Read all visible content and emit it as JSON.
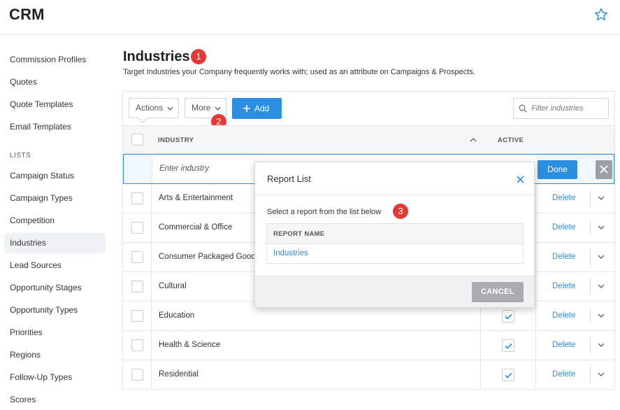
{
  "app": {
    "title": "CRM"
  },
  "sidebar": {
    "items_top": [
      "Commission Profiles",
      "Quotes",
      "Quote Templates",
      "Email Templates"
    ],
    "section_label": "LISTS",
    "items_lists": [
      "Campaign Status",
      "Campaign Types",
      "Competition",
      "Industries",
      "Lead Sources",
      "Opportunity Stages",
      "Opportunity Types",
      "Priorities",
      "Regions",
      "Follow-Up Types",
      "Scores"
    ],
    "active": "Industries"
  },
  "page": {
    "title": "Industries",
    "subtitle": "Target Industries your Company frequently works with; used as an attribute on Campaigns & Prospects."
  },
  "badges": {
    "b1": "1",
    "b2": "2",
    "b3": "3"
  },
  "toolbar": {
    "actions_label": "Actions",
    "more_label": "More",
    "add_label": "Add",
    "filter_placeholder": "Filter industries"
  },
  "table": {
    "col_industry": "INDUSTRY",
    "col_active": "ACTIVE",
    "new_placeholder": "Enter industry",
    "done_label": "Done",
    "delete_label": "Delete",
    "rows": [
      {
        "name": "Arts & Entertainment",
        "active": true
      },
      {
        "name": "Commercial & Office",
        "active": true
      },
      {
        "name": "Consumer Packaged Goods",
        "active": true
      },
      {
        "name": "Cultural",
        "active": true
      },
      {
        "name": "Education",
        "active": true
      },
      {
        "name": "Health & Science",
        "active": true
      },
      {
        "name": "Residential",
        "active": true
      }
    ]
  },
  "modal": {
    "title": "Report List",
    "prompt": "Select a report from the list below",
    "col_report_name": "REPORT NAME",
    "reports": [
      "Industries"
    ],
    "cancel_label": "CANCEL"
  },
  "colors": {
    "accent": "#2a8fe0",
    "badge": "#e53935",
    "cancel": "#a9adb2"
  }
}
